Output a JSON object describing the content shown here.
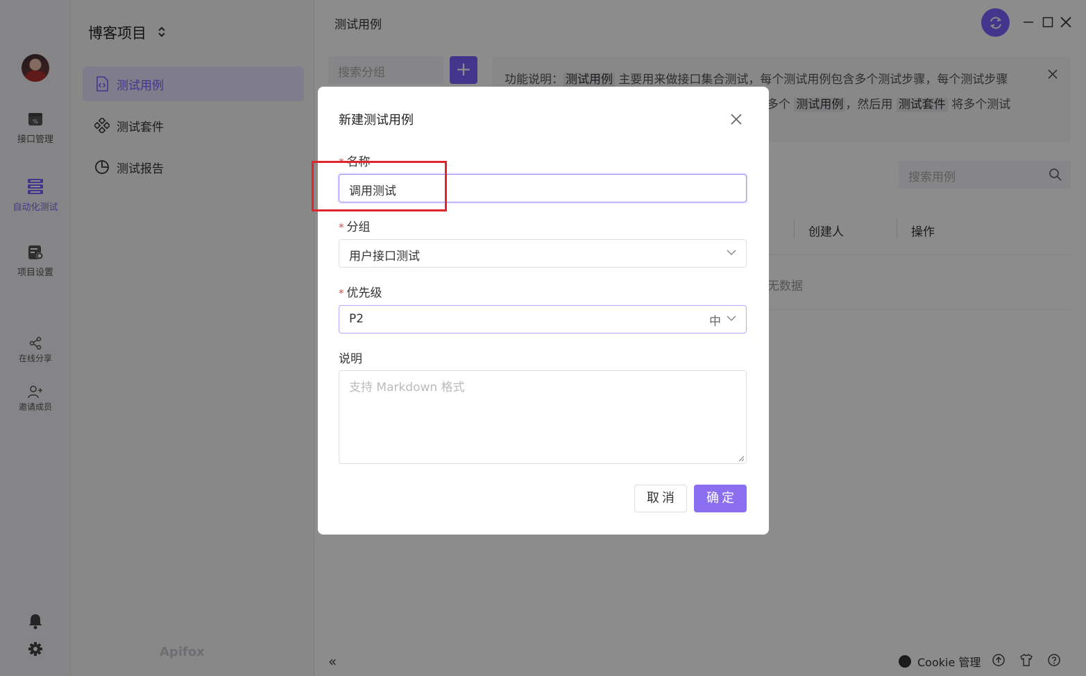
{
  "app": {
    "project_title": "博客项目",
    "page_title": "测试用例",
    "brand": "Apifox",
    "accent_color": "#7b61ff"
  },
  "rail": {
    "items": [
      {
        "label": "接口管理",
        "icon": "api-icon"
      },
      {
        "label": "自动化测试",
        "icon": "automation-icon"
      },
      {
        "label": "项目设置",
        "icon": "project-settings-icon"
      },
      {
        "label": "在线分享",
        "icon": "share-icon"
      },
      {
        "label": "邀请成员",
        "icon": "invite-icon"
      }
    ]
  },
  "sidebar": {
    "items": [
      {
        "label": "测试用例",
        "icon": "file-code-icon"
      },
      {
        "label": "测试套件",
        "icon": "diamond-grid-icon"
      },
      {
        "label": "测试报告",
        "icon": "pie-chart-icon"
      }
    ]
  },
  "main": {
    "search_group_placeholder": "搜索分组",
    "add_label": "+",
    "info": {
      "line1_prefix": "功能说明：",
      "hl1": "测试用例",
      "line1_rest": " 主要用来做接口集合测试，每个测试用例包含多个测试步骤，每个测试步骤",
      "line2_prefix": "多个 ",
      "hl2": "测试用例",
      "line2_mid": "，然后用 ",
      "hl3": "测试套件",
      "line2_rest": " 将多个测试"
    },
    "search_case_placeholder": "搜索用例",
    "columns": [
      "创建人",
      "操作"
    ],
    "empty_text": "无数据"
  },
  "footer": {
    "collapse": "«",
    "cookie_label": "Cookie 管理"
  },
  "modal": {
    "title": "新建测试用例",
    "name_label": "名称",
    "name_value": "调用测试",
    "group_label": "分组",
    "group_value": "用户接口测试",
    "priority_label": "优先级",
    "priority_value": "P2",
    "priority_sub": "中",
    "desc_label": "说明",
    "desc_placeholder": "支持 Markdown 格式",
    "cancel": "取消",
    "ok": "确定",
    "required_mark": "*"
  }
}
